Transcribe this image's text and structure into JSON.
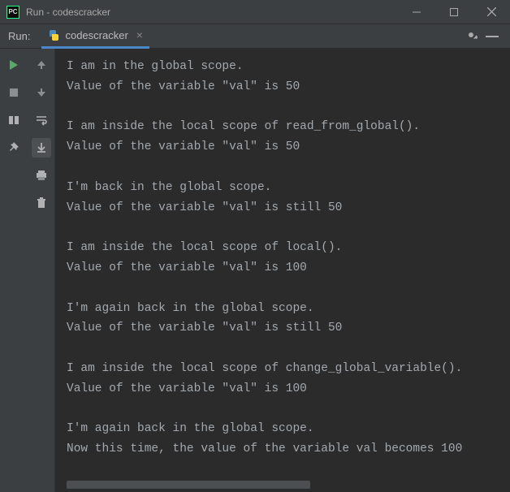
{
  "titlebar": {
    "app_icon_text": "PC",
    "title": "Run - codescracker"
  },
  "header": {
    "run_label": "Run:",
    "tab_name": "codescracker"
  },
  "console": {
    "lines": [
      "I am in the global scope.",
      "Value of the variable \"val\" is 50",
      "",
      "I am inside the local scope of read_from_global().",
      "Value of the variable \"val\" is 50",
      "",
      "I'm back in the global scope.",
      "Value of the variable \"val\" is still 50",
      "",
      "I am inside the local scope of local().",
      "Value of the variable \"val\" is 100",
      "",
      "I'm again back in the global scope.",
      "Value of the variable \"val\" is still 50",
      "",
      "I am inside the local scope of change_global_variable().",
      "Value of the variable \"val\" is 100",
      "",
      "I'm again back in the global scope.",
      "Now this time, the value of the variable val becomes 100"
    ]
  }
}
